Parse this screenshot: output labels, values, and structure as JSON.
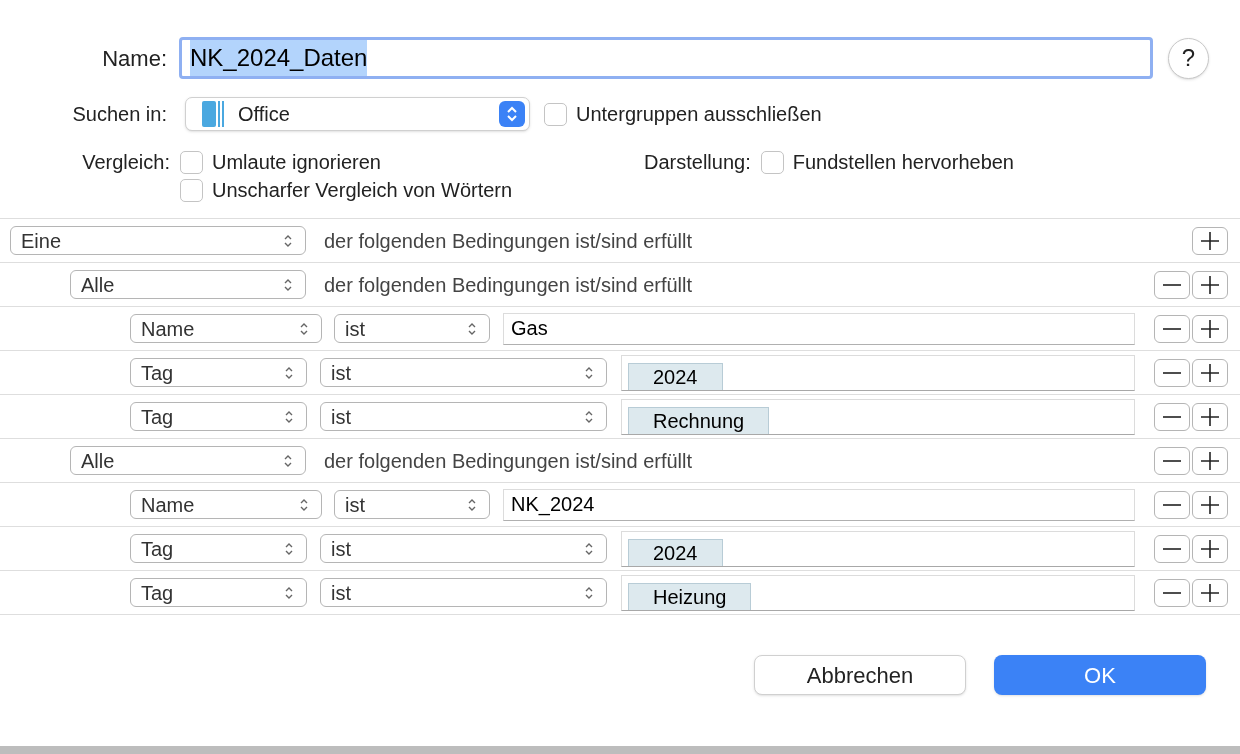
{
  "name_field": {
    "label": "Name:",
    "value": "NK_2024_Daten",
    "focused": true,
    "selected": true
  },
  "help_button": {
    "label": "?"
  },
  "search_in": {
    "label": "Suchen in:",
    "value": "Office"
  },
  "exclude_subgroups": {
    "label": "Untergruppen ausschließen",
    "checked": false
  },
  "compare": {
    "label": "Vergleich:",
    "options": [
      {
        "label": "Umlaute ignorieren",
        "checked": false
      },
      {
        "label": "Unscharfer Vergleich von Wörtern",
        "checked": false
      }
    ]
  },
  "display": {
    "label": "Darstellung:",
    "options": [
      {
        "label": "Fundstellen hervorheben",
        "checked": false
      }
    ]
  },
  "criteria": {
    "kind": "group",
    "quantifier": "Eine",
    "text": "der folgenden Bedingungen ist/sind erfüllt",
    "removable": false,
    "children": [
      {
        "kind": "group",
        "quantifier": "Alle",
        "text": "der folgenden Bedingungen ist/sind erfüllt",
        "removable": true,
        "children": [
          {
            "kind": "text",
            "field": "Name",
            "operator": "ist",
            "value": "Gas",
            "removable": true
          },
          {
            "kind": "tag",
            "field": "Tag",
            "operator": "ist",
            "tag": "2024",
            "removable": true
          },
          {
            "kind": "tag",
            "field": "Tag",
            "operator": "ist",
            "tag": "Rechnung",
            "removable": true
          }
        ]
      },
      {
        "kind": "group",
        "quantifier": "Alle",
        "text": "der folgenden Bedingungen ist/sind erfüllt",
        "removable": true,
        "children": [
          {
            "kind": "text",
            "field": "Name",
            "operator": "ist",
            "value": "NK_2024",
            "removable": true
          },
          {
            "kind": "tag",
            "field": "Tag",
            "operator": "ist",
            "tag": "2024",
            "removable": true
          },
          {
            "kind": "tag",
            "field": "Tag",
            "operator": "ist",
            "tag": "Heizung",
            "removable": true
          }
        ]
      }
    ]
  },
  "buttons": [
    {
      "label": "Abbrechen",
      "kind": "cancel"
    },
    {
      "label": "OK",
      "kind": "default"
    }
  ]
}
